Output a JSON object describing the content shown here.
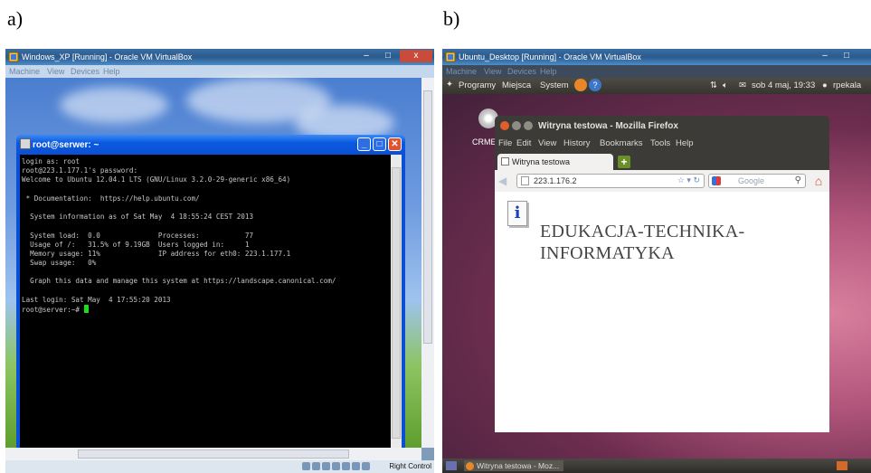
{
  "labels": {
    "a": "a)",
    "b": "b)"
  },
  "panel_a": {
    "window_title": "Windows_XP [Running] - Oracle VM VirtualBox",
    "menu": [
      "Machine",
      "View",
      "Devices",
      "Help"
    ],
    "putty_title": "root@serwer: ~",
    "terminal_lines": [
      "login as: root",
      "root@223.1.177.1's password:",
      "Welcome to Ubuntu 12.04.1 LTS (GNU/Linux 3.2.0-29-generic x86_64)",
      "",
      " * Documentation:  https://help.ubuntu.com/",
      "",
      "  System information as of Sat May  4 18:55:24 CEST 2013",
      "",
      "  System load:  0.0              Processes:           77",
      "  Usage of /:   31.5% of 9.19GB  Users logged in:     1",
      "  Memory usage: 11%              IP address for eth0: 223.1.177.1",
      "  Swap usage:   0%",
      "",
      "  Graph this data and manage this system at https://landscape.canonical.com/",
      "",
      "Last login: Sat May  4 17:55:20 2013"
    ],
    "prompt": "root@server:~# ",
    "status_right": "Right Control",
    "colors": {
      "title_bar": "#2b5a8c",
      "putty_frame": "#0b4fd4",
      "cursor": "#1ddc1d"
    }
  },
  "panel_b": {
    "window_title": "Ubuntu_Desktop [Running] - Oracle VM VirtualBox",
    "menu": [
      "Machine",
      "View",
      "Devices",
      "Help"
    ],
    "gnome_menu": [
      "Programy",
      "Miejsca",
      "System"
    ],
    "clock": "sob 4 maj, 19:33",
    "user": "rpekala",
    "desktop_icon_label": "CRMEF",
    "firefox_title": "Witryna testowa - Mozilla Firefox",
    "firefox_menu": [
      "File",
      "Edit",
      "View",
      "History",
      "Bookmarks",
      "Tools",
      "Help"
    ],
    "tab_label": "Witryna testowa",
    "url": "223.1.176.2",
    "search_placeholder": "Google",
    "page_heading_line1": "EDUKACJA-TECHNIKA-",
    "page_heading_line2": "INFORMATYKA",
    "taskbar_item": "Witryna testowa - Moz...",
    "colors": {
      "desktop": "#b3567c",
      "panel": "#3c3b37",
      "close_button": "#e05d2c"
    }
  }
}
